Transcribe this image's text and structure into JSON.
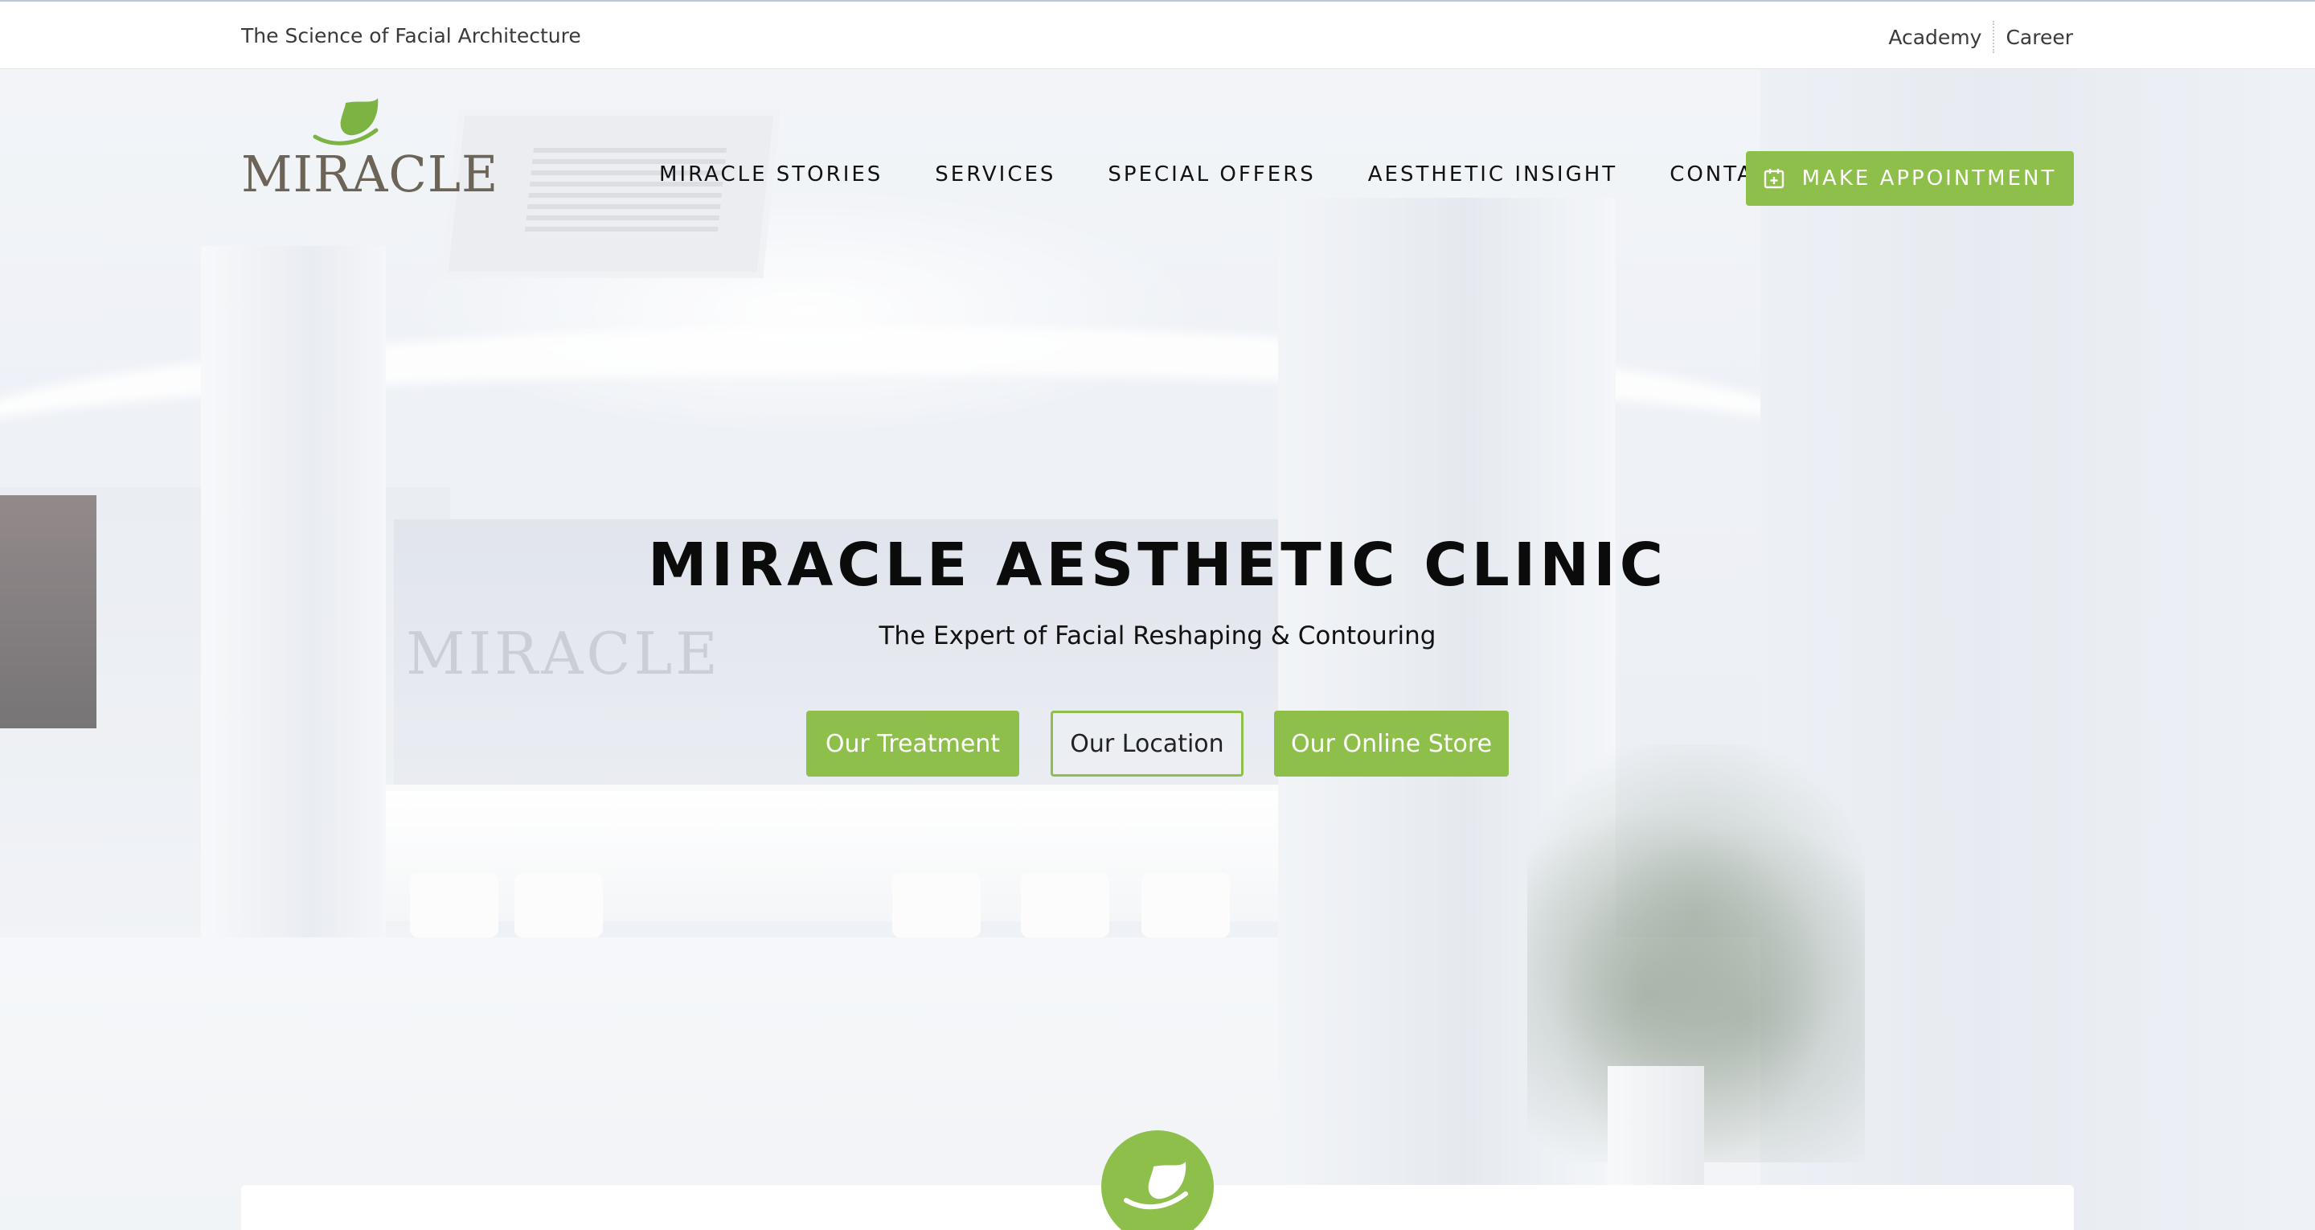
{
  "topbar": {
    "tagline": "The Science of Facial Architecture",
    "links": [
      "Academy",
      "Career"
    ]
  },
  "brand": {
    "logo_text": "MIRACLE",
    "logo_icon": "leaf-icon",
    "logo_color": "#6c6457",
    "leaf_color": "#7cb342"
  },
  "nav": {
    "items": [
      "MIRACLE STORIES",
      "SERVICES",
      "SPECIAL OFFERS",
      "AESTHETIC INSIGHT",
      "CONTACT"
    ],
    "appointment_label": "MAKE APPOINTMENT",
    "appointment_icon": "calendar-plus-icon"
  },
  "hero": {
    "title": "MIRACLE AESTHETIC CLINIC",
    "subtitle": "The Expert of Facial Reshaping & Contouring",
    "buttons": [
      "Our Treatment",
      "Our Location",
      "Our Online Store"
    ],
    "background_sign": "MIRACLE"
  },
  "colors": {
    "accent": "#8dbf4a",
    "text": "#111111"
  }
}
